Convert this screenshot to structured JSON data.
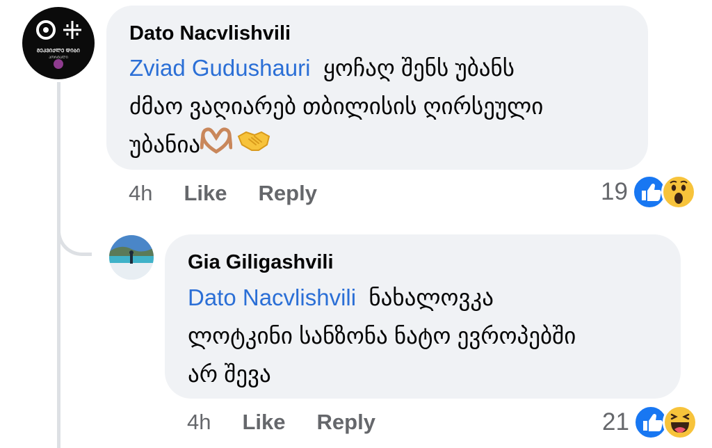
{
  "comments": [
    {
      "author": "Dato Nacvlishvili",
      "mention": "Zviad Gudushauri",
      "line1_rest": "ყოჩაღ შენს უბანს",
      "line2": "ძმაო ვაღიარებ თბილისის ღირსეული",
      "line3": "უბანია",
      "emojis": [
        "heart-hands-icon",
        "handshake-icon"
      ],
      "time": "4h",
      "like_label": "Like",
      "reply_label": "Reply",
      "reaction_count": "19",
      "reactions": [
        "like-icon",
        "wow-icon"
      ],
      "avatar_text": "ᲛᲔᲙᲕᲘᲥᲚᲔ ᲓᲘᲑᲘ",
      "avatar_subtext": "ᲞᲝᲠᲢᲐᲚᲘ"
    },
    {
      "author": "Gia Giligashvili",
      "mention": "Dato Nacvlishvili",
      "line1_rest": "ნახალოვკა",
      "line2": "ლოტკინი სანზონა ნატო ევროპებში",
      "line3": "არ შევა",
      "time": "4h",
      "like_label": "Like",
      "reply_label": "Reply",
      "reaction_count": "21",
      "reactions": [
        "like-icon",
        "haha-icon"
      ]
    }
  ],
  "colors": {
    "bubble": "#f0f2f5",
    "mention": "#2b6fd6",
    "meta": "#65676b",
    "like_blue": "#1877f2",
    "emoji_yellow": "#f7c33b"
  }
}
